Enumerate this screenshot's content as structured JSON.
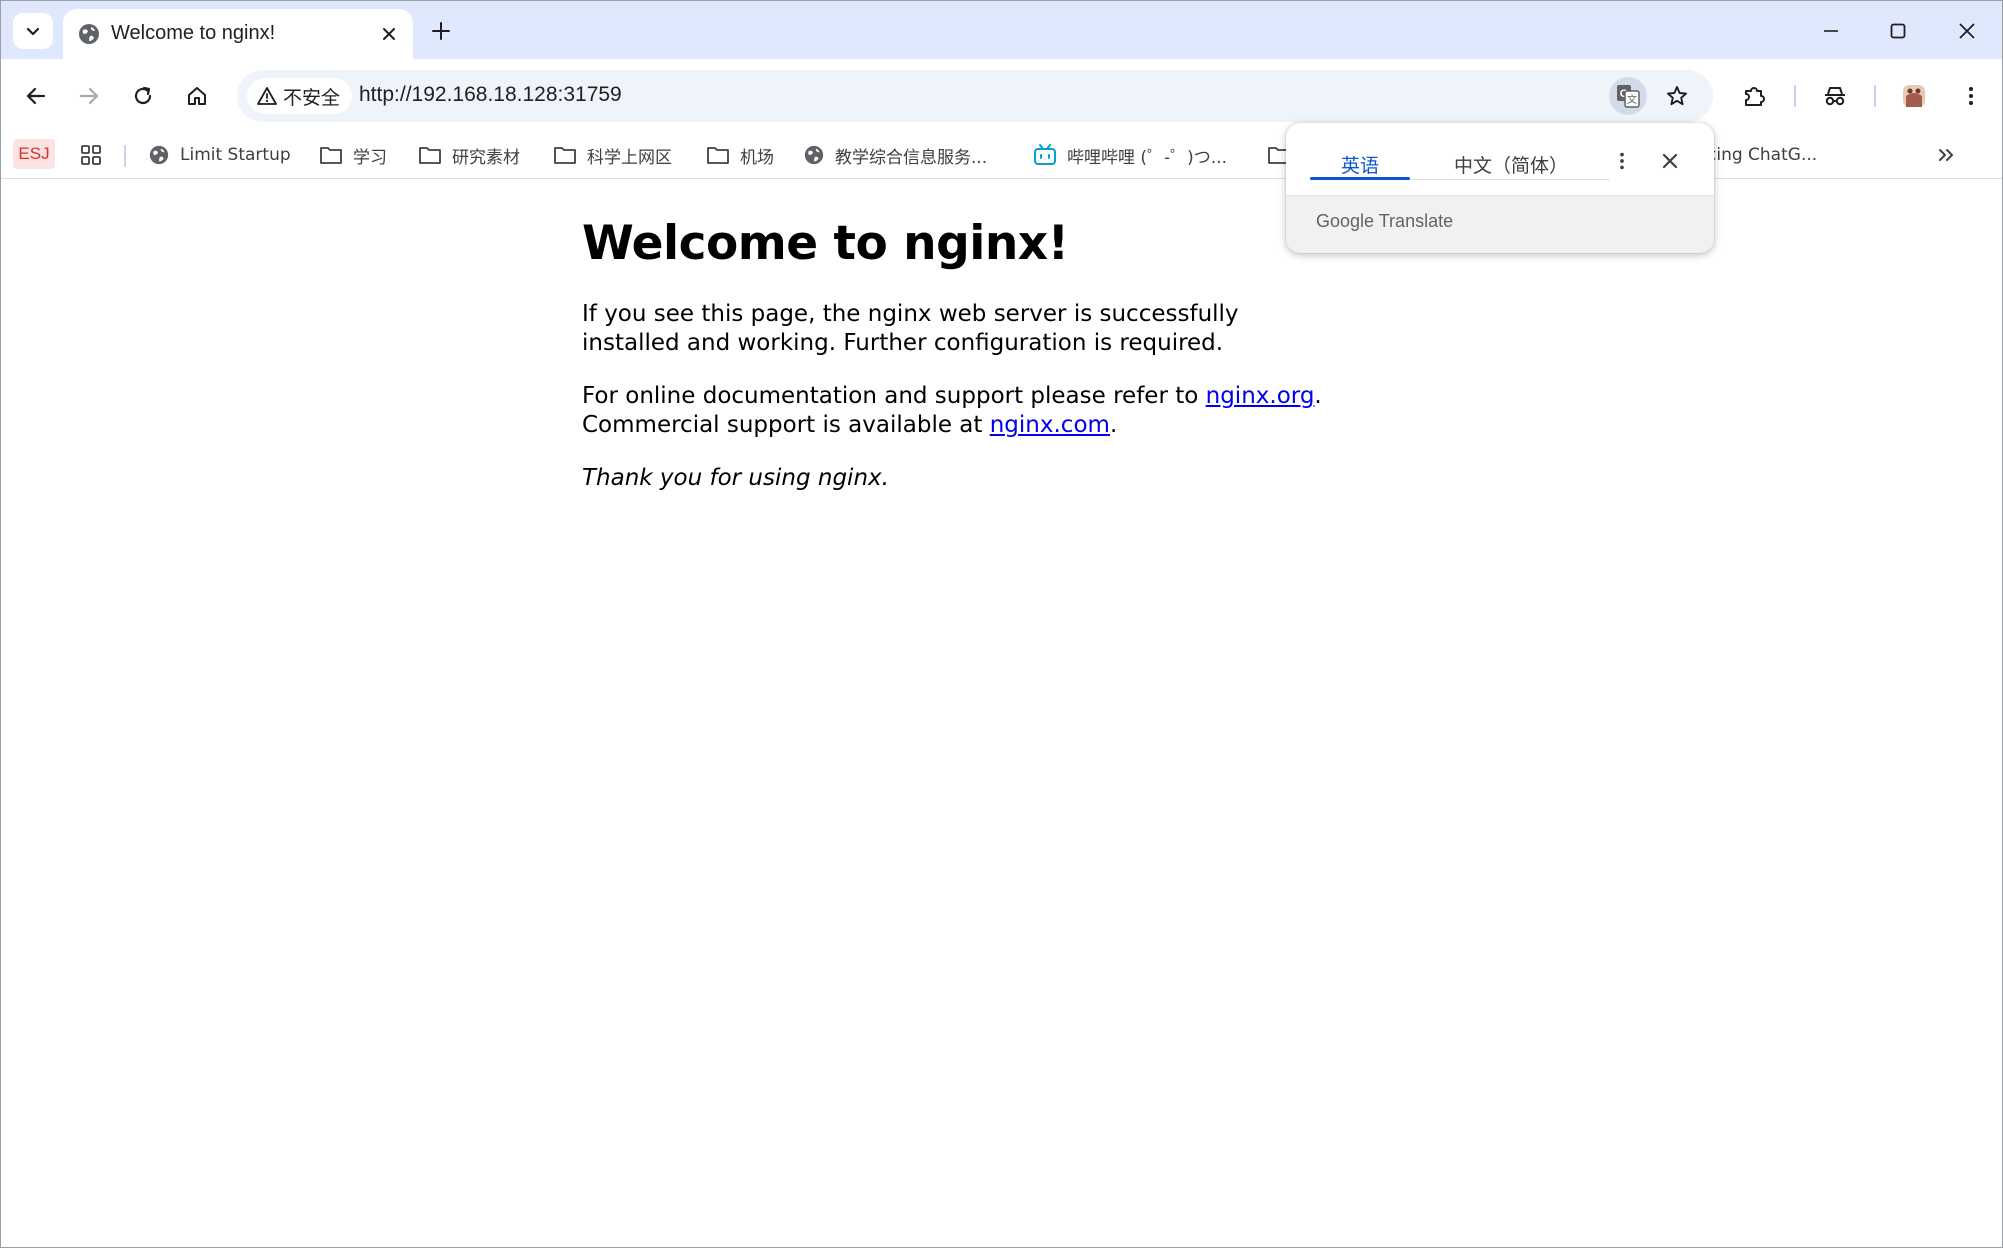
{
  "browser": {
    "tab": {
      "title": "Welcome to nginx!"
    },
    "omnibox": {
      "security_label": "不安全",
      "url": "http://192.168.18.128:31759"
    },
    "bookmarks": {
      "esj": "ESJ",
      "items": [
        {
          "label": "Limit Startup",
          "icon": "globe-icon"
        },
        {
          "label": "学习",
          "icon": "folder-icon"
        },
        {
          "label": "研究素材",
          "icon": "folder-icon"
        },
        {
          "label": "科学上网区",
          "icon": "folder-icon"
        },
        {
          "label": "机场",
          "icon": "folder-icon"
        },
        {
          "label": "教学综合信息服务...",
          "icon": "globe-icon"
        },
        {
          "label": "哔哩哔哩 (゜-゜)つ...",
          "icon": "bilibili-icon"
        },
        {
          "label": "cing ChatG...",
          "icon": ""
        }
      ]
    }
  },
  "translate_popup": {
    "source_language": "英语",
    "target_language": "中文（简体）",
    "brand_google": "Google",
    "brand_translate": "Translate"
  },
  "page": {
    "heading": "Welcome to nginx!",
    "para1": "If you see this page, the nginx web server is successfully installed and working. Further configuration is required.",
    "para2_prefix": "For online documentation and support please refer to ",
    "link_org": "nginx.org",
    "para2_mid": ".",
    "para2_line2": "Commercial support is available at ",
    "link_com": "nginx.com",
    "para2_end": ".",
    "thanks": "Thank you for using nginx."
  },
  "colors": {
    "tabstrip": "#dfe8fd",
    "omnibox": "#eff3fa",
    "accent": "#0b57d0",
    "link": "#0000ee"
  }
}
